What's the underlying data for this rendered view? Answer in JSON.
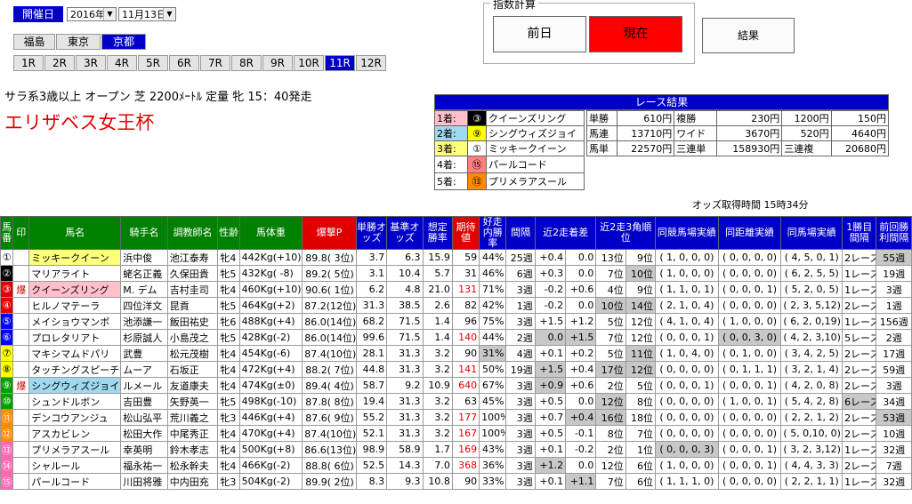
{
  "header": {
    "date_label": "開催日",
    "year": "2016年",
    "day": "11月13日",
    "venues": [
      "福島",
      "東京",
      "京都"
    ],
    "races": [
      "1R",
      "2R",
      "3R",
      "4R",
      "5R",
      "6R",
      "7R",
      "8R",
      "9R",
      "10R",
      "11R",
      "12R"
    ],
    "race_info": "サラ系3歳以上 オープン 芝 2200ﾒｰﾄﾙ 定量 牝 15：40発走",
    "race_name": "エリザベス女王杯"
  },
  "index_calc": {
    "legend": "指数計算",
    "prev": "前日",
    "now": "現在",
    "result": "結果"
  },
  "results": {
    "title": "レース結果",
    "finish": [
      {
        "place": "1着:",
        "num": "③",
        "name": "クイーンズリング"
      },
      {
        "place": "2着:",
        "num": "⑨",
        "name": "シングウィズジョイ"
      },
      {
        "place": "3着:",
        "num": "①",
        "name": "ミッキークイーン"
      },
      {
        "place": "4着:",
        "num": "⑮",
        "name": "パールコード"
      },
      {
        "place": "5着:",
        "num": "⑬",
        "name": "プリメラアスール"
      }
    ],
    "payouts": [
      [
        "単勝",
        "610円",
        "複勝",
        "230円",
        "1200円",
        "150円"
      ],
      [
        "馬連",
        "13710円",
        "ワイド",
        "3670円",
        "520円",
        "4640円"
      ],
      [
        "馬単",
        "22570円",
        "三連単",
        "158930円",
        "三連複",
        "20680円"
      ]
    ]
  },
  "odds_time": "オッズ取得時間 15時34分",
  "columns": [
    "馬番",
    "印",
    "馬名",
    "騎手名",
    "調教師名",
    "性齢",
    "馬体重",
    "爆撃P",
    "単勝オッズ",
    "基準オッズ",
    "想定勝率",
    "期待値",
    "好走内勝率",
    "間隔",
    "近2走着差",
    "",
    "近2走3角順位",
    "",
    "同競馬場実績",
    "同距離実績",
    "同馬場実績",
    "1勝目間隔",
    "前回勝利間隔"
  ],
  "rows": [
    [
      "①",
      "",
      "ミッキークイーン",
      "浜中俊",
      "池江泰寿",
      "牝4",
      "442Kg(+10)",
      "89.8( 3位)",
      "3.7",
      "6.3",
      "15.9",
      "59",
      "44%",
      "25週",
      "+0.4",
      "0.0",
      "13位",
      "9位",
      "( 1, 0, 0, 0)",
      "( 0, 0, 0, 0)",
      "( 4, 5, 0, 1)",
      "2レース",
      "55週"
    ],
    [
      "②",
      "",
      "マリアライト",
      "蛯名正義",
      "久保田貴",
      "牝5",
      "432Kg( -8)",
      "89.2( 5位)",
      "3.1",
      "10.4",
      "5.7",
      "31",
      "46%",
      "6週",
      "+0.3",
      "0.0",
      "7位",
      "10位",
      "( 1, 0, 0, 0)",
      "( 0, 0, 0, 0)",
      "( 6, 2, 5, 5)",
      "1レース",
      "19週"
    ],
    [
      "③",
      "爆",
      "クイーンズリング",
      "M. デム",
      "吉村圭司",
      "牝4",
      "460Kg(+10)",
      "90.6( 1位)",
      "6.2",
      "4.8",
      "21.0",
      "131",
      "71%",
      "3週",
      "-0.2",
      "+0.6",
      "4位",
      "9位",
      "( 1, 1, 0, 1)",
      "( 0, 0, 0, 1)",
      "( 5, 2, 0, 5)",
      "1レース",
      "3週"
    ],
    [
      "④",
      "",
      "ヒルノマテーラ",
      "四位洋文",
      "昆貢",
      "牝5",
      "464Kg(+2)",
      "87.2(12位)",
      "31.3",
      "38.5",
      "2.6",
      "82",
      "42%",
      "1週",
      "-0.2",
      "0.0",
      "10位",
      "14位",
      "( 2, 1, 0, 4)",
      "( 0, 0, 0, 0)",
      "( 2, 3, 5,12)",
      "2レース",
      "1週"
    ],
    [
      "⑤",
      "",
      "メイショウマンボ",
      "池添謙一",
      "飯田祐史",
      "牝6",
      "488Kg(+4)",
      "86.0(14位)",
      "68.2",
      "71.5",
      "1.4",
      "96",
      "75%",
      "3週",
      "+1.5",
      "+1.2",
      "5位",
      "12位",
      "( 4, 1, 0, 4)",
      "( 1, 0, 0, 0)",
      "( 6, 2, 0,19)",
      "1レース",
      "156週"
    ],
    [
      "⑥",
      "",
      "プロレタリアト",
      "杉原誠人",
      "小島茂之",
      "牝5",
      "428Kg(-2)",
      "86.0(14位)",
      "99.6",
      "71.5",
      "1.4",
      "140",
      "44%",
      "2週",
      "0.0",
      "+1.5",
      "7位",
      "12位",
      "( 0, 0, 0, 1)",
      "( 0, 0, 3, 0)",
      "( 4, 2, 3,10)",
      "5レース",
      "2週"
    ],
    [
      "⑦",
      "",
      "マキシマムドパリ",
      "武豊",
      "松元茂樹",
      "牝4",
      "454Kg(-6)",
      "87.4(10位)",
      "28.1",
      "31.3",
      "3.2",
      "90",
      "31%",
      "4週",
      "+0.1",
      "+0.2",
      "5位",
      "11位",
      "( 1, 0, 4, 0)",
      "( 0, 1, 0, 0)",
      "( 3, 4, 2, 5)",
      "2レース",
      "17週"
    ],
    [
      "⑧",
      "",
      "タッチングスピーチ",
      "ムーア",
      "石坂正",
      "牝4",
      "472Kg(+4)",
      "88.2( 7位)",
      "44.8",
      "31.3",
      "3.2",
      "141",
      "50%",
      "19週",
      "+1.5",
      "+0.4",
      "17位",
      "12位",
      "( 0, 0, 0, 0)",
      "( 0, 1, 1, 1)",
      "( 3, 2, 1, 4)",
      "2レース",
      "59週"
    ],
    [
      "⑨",
      "爆",
      "シングウィズジョイ",
      "ルメール",
      "友道康夫",
      "牝4",
      "474Kg(±0)",
      "89.4( 4位)",
      "58.7",
      "9.2",
      "10.9",
      "640",
      "67%",
      "3週",
      "+0.9",
      "+0.6",
      "2位",
      "5位",
      "( 0, 0, 0, 1)",
      "( 0, 0, 0, 1)",
      "( 4, 2, 0, 8)",
      "2レース",
      "3週"
    ],
    [
      "⑩",
      "",
      "シュンドルボン",
      "吉田豊",
      "矢野英一",
      "牝5",
      "498Kg(-10)",
      "87.8( 8位)",
      "19.4",
      "31.3",
      "3.2",
      "63",
      "45%",
      "3週",
      "+0.5",
      "0.0",
      "12位",
      "8位",
      "( 0, 0, 0, 0)",
      "( 1, 0, 0, 1)",
      "( 5, 4, 2, 8)",
      "6レース",
      "34週"
    ],
    [
      "⑪",
      "",
      "デンコウアンジュ",
      "松山弘平",
      "荒川義之",
      "牝3",
      "446Kg(+4)",
      "87.6( 9位)",
      "55.2",
      "31.3",
      "3.2",
      "177",
      "100%",
      "3週",
      "+0.7",
      "+0.4",
      "16位",
      "18位",
      "( 0, 0, 0, 0)",
      "( 0, 0, 0, 0)",
      "( 2, 2, 1, 2)",
      "2レース",
      "53週"
    ],
    [
      "⑫",
      "",
      "アスカビレン",
      "松田大作",
      "中尾秀正",
      "牝4",
      "470Kg(+4)",
      "87.4(10位)",
      "52.1",
      "31.3",
      "3.2",
      "167",
      "100%",
      "3週",
      "+0.5",
      "-0.1",
      "8位",
      "7位",
      "( 0, 0, 0, 0)",
      "( 0, 0, 0, 0)",
      "( 5, 0,10, 0)",
      "2レース",
      "10週"
    ],
    [
      "⑬",
      "",
      "プリメラアスール",
      "幸英明",
      "鈴木孝志",
      "牝4",
      "500Kg(+8)",
      "86.6(13位)",
      "98.9",
      "58.9",
      "1.7",
      "169",
      "43%",
      "3週",
      "+0.1",
      "-0.2",
      "2位",
      "1位",
      "( 0, 0, 0, 3)",
      "( 0, 0, 0, 1)",
      "( 3, 2, 3,12)",
      "1レース",
      "32週"
    ],
    [
      "⑭",
      "",
      "シャルール",
      "福永祐一",
      "松永幹夫",
      "牝4",
      "466Kg(-2)",
      "88.8( 6位)",
      "52.5",
      "14.3",
      "7.0",
      "368",
      "36%",
      "3週",
      "+1.2",
      "0.0",
      "12位",
      "6位",
      "( 1, 0, 0, 0)",
      "( 0, 0, 0, 1)",
      "( 4, 4, 3, 3)",
      "2レース",
      "7週"
    ],
    [
      "⑮",
      "",
      "パールコード",
      "川田将雅",
      "中内田充",
      "牝3",
      "504Kg(-2)",
      "89.9( 2位)",
      "8.3",
      "9.3",
      "10.8",
      "90",
      "33%",
      "3週",
      "+0.1",
      "+1.1",
      "7位",
      "6位",
      "( 1, 1, 1, 0)",
      "( 0, 0, 0, 0)",
      "( 2, 2, 1, 1)",
      "1レース",
      "32週"
    ]
  ],
  "colors": {
    "accent_blue": "#0000c8",
    "green": "#008000",
    "red": "#e00000",
    "gray": "#c8c8c8"
  }
}
